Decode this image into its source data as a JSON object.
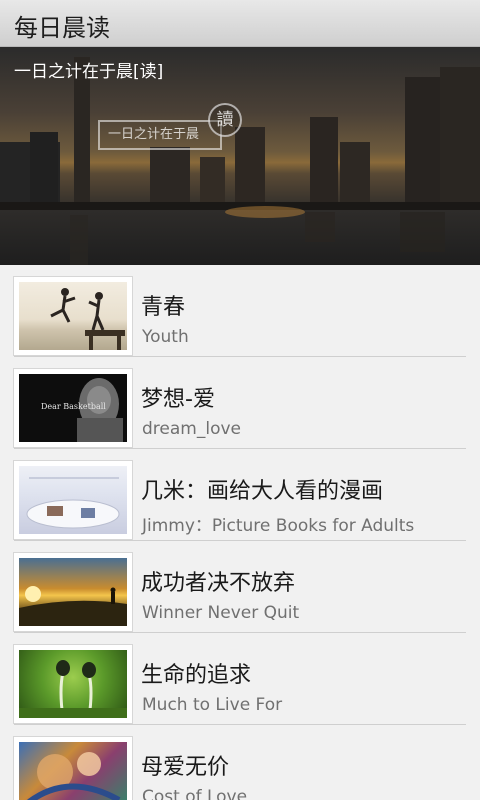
{
  "app": {
    "title": "每日晨读"
  },
  "banner": {
    "caption": "一日之计在于晨[读]",
    "badge_text": "一日之计在于晨",
    "badge_seal": "讀"
  },
  "articles": [
    {
      "title": "青春",
      "subtitle": "Youth",
      "thumb_text": ""
    },
    {
      "title": "梦想-爱",
      "subtitle": "dream_love",
      "thumb_text": "Dear Basketball"
    },
    {
      "title": "几米：画给大人看的漫画",
      "subtitle": "Jimmy：Picture Books for Adults",
      "thumb_text": ""
    },
    {
      "title": "成功者决不放弃",
      "subtitle": "Winner Never Quit",
      "thumb_text": ""
    },
    {
      "title": "生命的追求",
      "subtitle": "Much to Live For",
      "thumb_text": ""
    },
    {
      "title": "母爱无价",
      "subtitle": "Cost of Love",
      "thumb_text": ""
    }
  ]
}
